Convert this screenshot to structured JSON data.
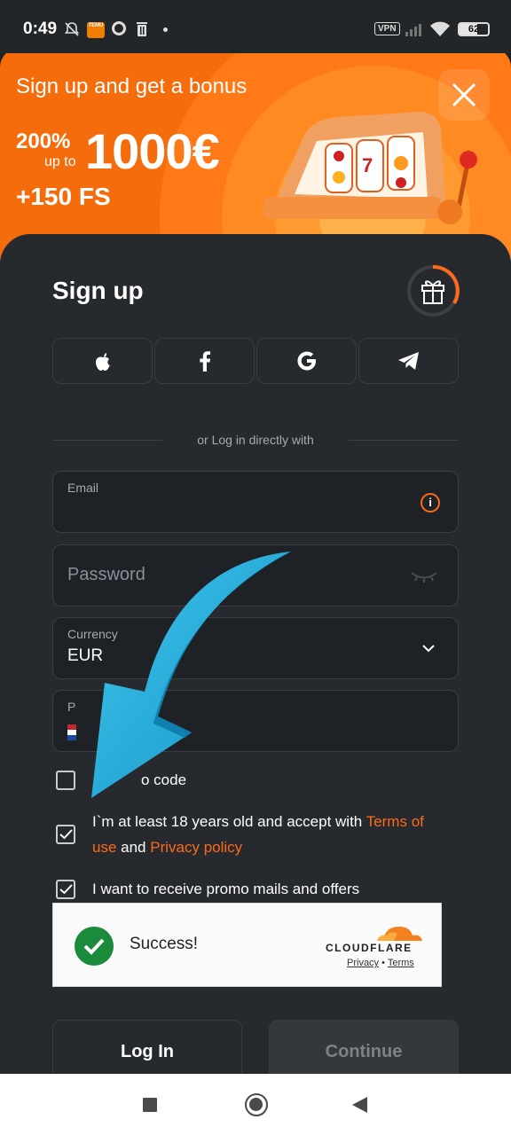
{
  "status_bar": {
    "time": "0:49",
    "app_badge": "TEMU",
    "vpn": "VPN",
    "battery": "62"
  },
  "banner": {
    "title": "Sign up and get a bonus",
    "percent": "200%",
    "up_to": "up to",
    "amount": "1000€",
    "free_spins": "+150 FS",
    "accent_color": "#ff7a16"
  },
  "form": {
    "title": "Sign up",
    "social_icons": [
      "apple-icon",
      "facebook-icon",
      "google-icon",
      "telegram-icon"
    ],
    "divider_text": "or Log in directly with",
    "email": {
      "label": "Email",
      "value": ""
    },
    "password": {
      "placeholder": "Password"
    },
    "currency": {
      "label": "Currency",
      "value": "EUR"
    },
    "phone": {
      "label": "P"
    },
    "promo_checkbox": {
      "label": "o code",
      "checked": false
    },
    "age_checkbox": {
      "text_before": "I`m at least 18 years old and accept with ",
      "terms_link": "Terms of",
      "terms_link_2": "use",
      "and_text": " and ",
      "privacy_link": "Privacy policy",
      "checked": true
    },
    "promo_mail_checkbox": {
      "label": "I want to receive promo mails and offers",
      "checked": true
    },
    "link_color": "#ff6a1a"
  },
  "captcha": {
    "status": "Success!",
    "brand": "CLOUDFLARE",
    "privacy_link": "Privacy",
    "separator": "•",
    "terms_link": "Terms"
  },
  "buttons": {
    "login": "Log In",
    "continue": "Continue"
  }
}
